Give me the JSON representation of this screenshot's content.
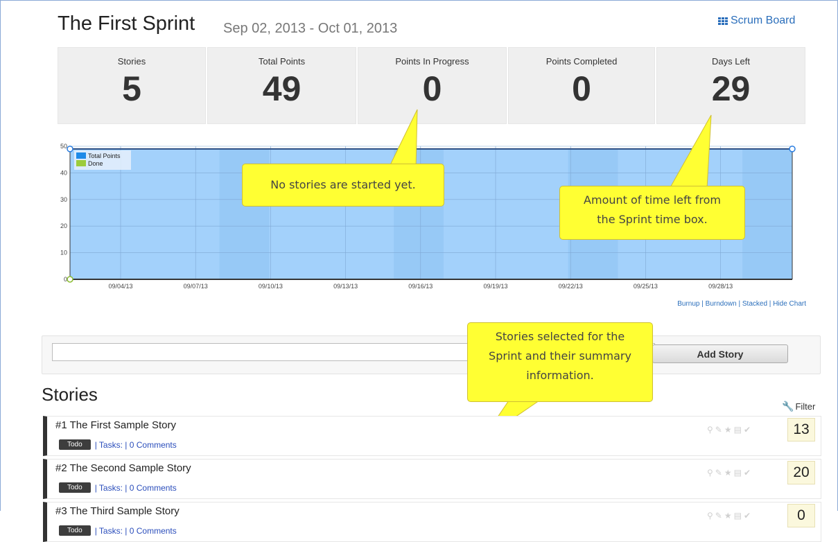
{
  "sprint": {
    "title": "The First Sprint",
    "dates": "Sep 02, 2013 - Oct 01, 2013",
    "scrum_board_label": "Scrum Board"
  },
  "stats": [
    {
      "label": "Stories",
      "value": "5"
    },
    {
      "label": "Total Points",
      "value": "49"
    },
    {
      "label": "Points In Progress",
      "value": "0"
    },
    {
      "label": "Points Completed",
      "value": "0"
    },
    {
      "label": "Days Left",
      "value": "29"
    }
  ],
  "chart_data": {
    "type": "area",
    "y_ticks": [
      "0",
      "10",
      "20",
      "30",
      "40",
      "50"
    ],
    "x_ticks": [
      "09/04/13",
      "09/07/13",
      "09/10/13",
      "09/13/13",
      "09/16/13",
      "09/19/13",
      "09/22/13",
      "09/25/13",
      "09/28/13"
    ],
    "ylim": [
      0,
      50
    ],
    "series": [
      {
        "name": "Total Points",
        "color": "#1e8ae8",
        "values": [
          49,
          49
        ]
      },
      {
        "name": "Done",
        "color": "#9ccc3c",
        "values": [
          0,
          0
        ]
      }
    ],
    "legend_position": "top-left"
  },
  "chart_links": {
    "burnup": "Burnup",
    "burndown": "Burndown",
    "stacked": "Stacked",
    "hide": "Hide Chart"
  },
  "callouts": {
    "no_stories": "No stories are started yet.",
    "time_left_1": "Amount of time left from",
    "time_left_2": "the Sprint time box.",
    "selected_1": "Stories selected for the",
    "selected_2": "Sprint and their summary",
    "selected_3": "information."
  },
  "add_story": {
    "input_value": "",
    "button_label": "Add Story"
  },
  "stories_heading": "Stories",
  "filter_label": "Filter",
  "stories": [
    {
      "title": "#1 The First Sample Story",
      "status": "Todo",
      "tasks": "| Tasks:",
      "comments": "| 0 Comments",
      "points": "13"
    },
    {
      "title": "#2 The Second Sample Story",
      "status": "Todo",
      "tasks": "| Tasks:",
      "comments": "| 0 Comments",
      "points": "20"
    },
    {
      "title": "#3 The Third Sample Story",
      "status": "Todo",
      "tasks": "| Tasks:",
      "comments": "| 0 Comments",
      "points": "0"
    }
  ],
  "colors": {
    "accent": "#2a6ebb",
    "chart_fill": "#a3d1fb",
    "callout": "#ffff33"
  }
}
